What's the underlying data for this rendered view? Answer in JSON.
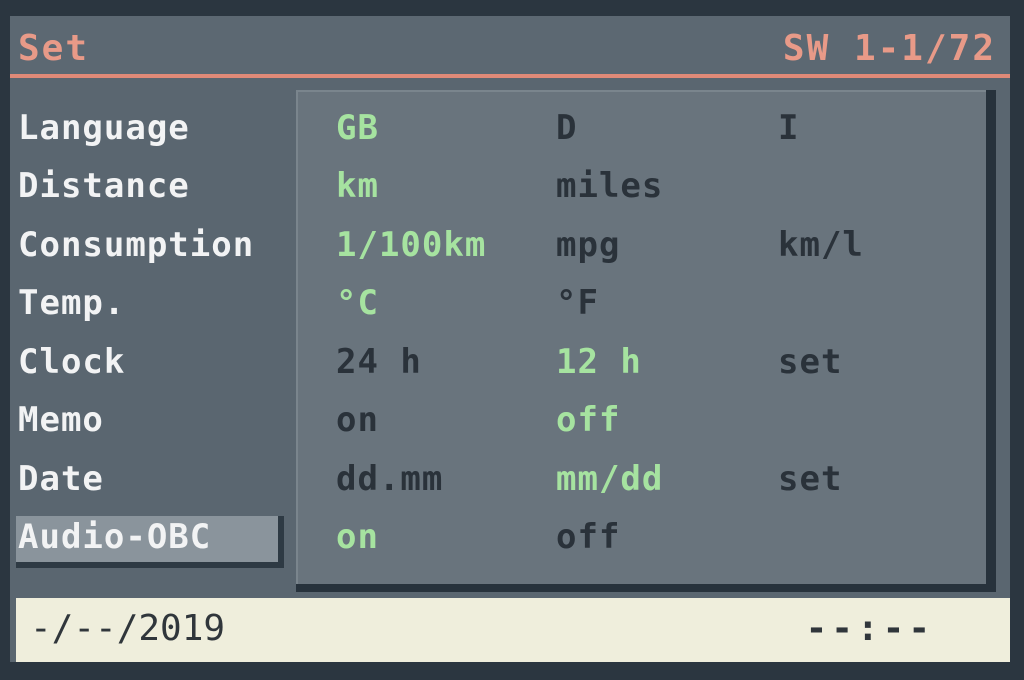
{
  "header": {
    "title": "Set",
    "page_indicator": "SW 1-1/72"
  },
  "settings": [
    {
      "label": "Language",
      "options": [
        "GB",
        "D",
        "I"
      ],
      "selected_index": 0
    },
    {
      "label": "Distance",
      "options": [
        "km",
        "miles"
      ],
      "selected_index": 0
    },
    {
      "label": "Consumption",
      "options": [
        "1/100km",
        "mpg",
        "km/l"
      ],
      "selected_index": 0
    },
    {
      "label": "Temp.",
      "options": [
        "°C",
        "°F"
      ],
      "selected_index": 0
    },
    {
      "label": "Clock",
      "options": [
        "24 h",
        "12 h",
        "set"
      ],
      "selected_index": 1
    },
    {
      "label": "Memo",
      "options": [
        "on",
        "off"
      ],
      "selected_index": 1
    },
    {
      "label": "Date",
      "options": [
        "dd.mm",
        "mm/dd",
        "set"
      ],
      "selected_index": 1
    },
    {
      "label": "Audio-OBC",
      "options": [
        "on",
        "off"
      ],
      "selected_index": 0,
      "highlighted": true
    }
  ],
  "footer": {
    "date": "-/--/2019",
    "time": "--:--"
  },
  "colors": {
    "header_text": "#e89a88",
    "selected_option": "#a6e3a0",
    "unselected_option": "#2a323a",
    "label_text": "#f2f3f4",
    "footer_background": "#efeedc"
  }
}
